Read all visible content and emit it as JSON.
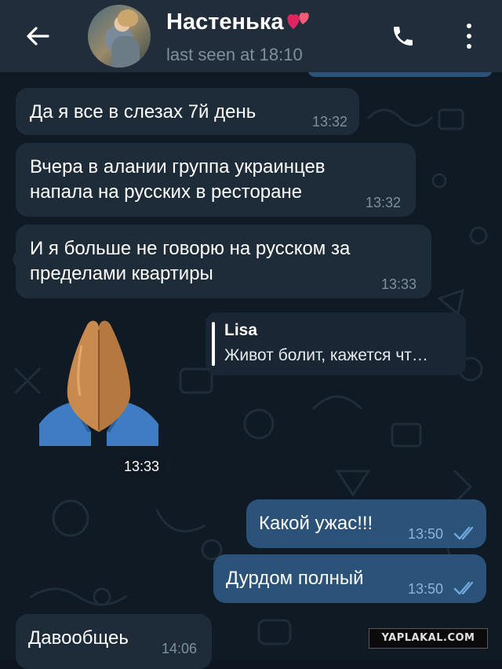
{
  "header": {
    "contact_name": "Настенька",
    "last_seen": "last seen at 18:10",
    "back_icon": "arrow-left-icon",
    "call_icon": "phone-icon",
    "more_icon": "more-vertical-icon"
  },
  "messages": [
    {
      "direction": "incoming",
      "text": "Да я все в слезах 7й день",
      "time": "13:32"
    },
    {
      "direction": "incoming",
      "text_lines": [
        "Вчера в алании группа украинцев",
        "напала на русских в ресторане"
      ],
      "time": "13:32"
    },
    {
      "direction": "incoming",
      "text_lines": [
        "И я больше не говорю на русском за",
        "пределами квартиры"
      ],
      "time": "13:33"
    },
    {
      "direction": "incoming",
      "type": "sticker",
      "sticker": "folded-hands-emoji",
      "time": "13:33",
      "reply_to": {
        "name": "Lisa",
        "text": "Живот болит, кажется чт…"
      }
    },
    {
      "direction": "outgoing",
      "text": "Какой ужас!!!",
      "time": "13:50",
      "status": "read"
    },
    {
      "direction": "outgoing",
      "text": "Дурдом полный",
      "time": "13:50",
      "status": "read"
    },
    {
      "direction": "incoming",
      "text": "Давообщеь",
      "time": "14:06"
    }
  ],
  "watermark": "YAPLAKAL.COM",
  "colors": {
    "header_bg": "#212d3b",
    "chat_bg": "#101a24",
    "incoming_bubble": "#1e2c3a",
    "outgoing_bubble": "#2b5278",
    "read_ticks": "#6fa8dc"
  }
}
